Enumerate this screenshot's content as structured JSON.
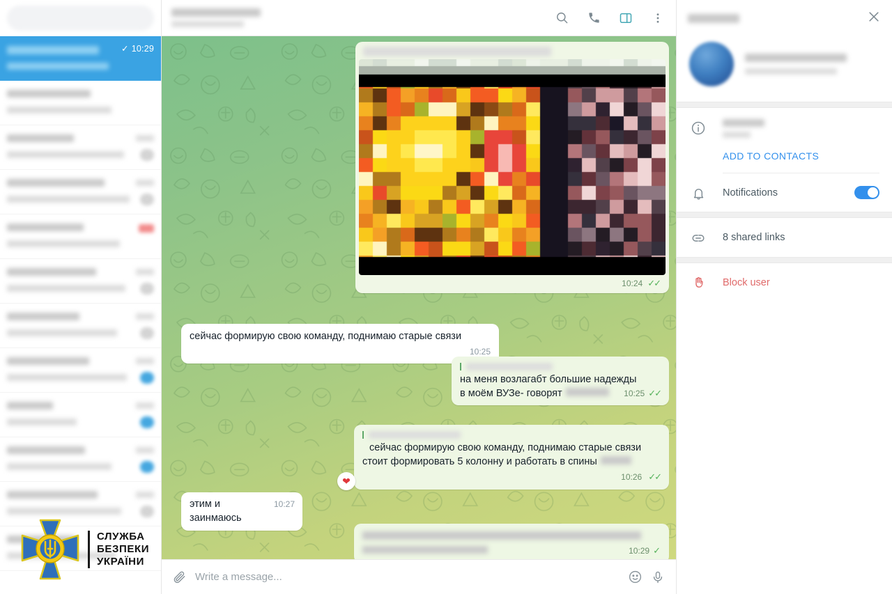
{
  "sidebar": {
    "search": {
      "placeholder": "",
      "value": ""
    },
    "selected_chat": {
      "time": "10:29",
      "check": "✓"
    },
    "rows": [
      {
        "name_w": 120,
        "snippet_w": 150,
        "badge": "none"
      },
      {
        "name_w": 96,
        "snippet_w": 168,
        "badge": "grey"
      },
      {
        "name_w": 140,
        "snippet_w": 176,
        "badge": "grey"
      },
      {
        "name_w": 110,
        "snippet_w": 162,
        "badge": "red"
      },
      {
        "name_w": 128,
        "snippet_w": 170,
        "badge": "grey"
      },
      {
        "name_w": 104,
        "snippet_w": 158,
        "badge": "grey"
      },
      {
        "name_w": 118,
        "snippet_w": 172,
        "badge": "blue"
      },
      {
        "name_w": 66,
        "snippet_w": 100,
        "badge": "blue"
      },
      {
        "name_w": 112,
        "snippet_w": 150,
        "badge": "blue"
      },
      {
        "name_w": 130,
        "snippet_w": 164,
        "badge": "grey"
      },
      {
        "name_w": 98,
        "snippet_w": 156,
        "badge": "none"
      }
    ],
    "watermark": {
      "line1": "СЛУЖБА",
      "line2": "БЕЗПЕКИ",
      "line3": "УКРАЇНИ",
      "emblem_colors": {
        "cross": "#2e6fba",
        "gold": "#f3c912",
        "outline": "#15488f"
      }
    }
  },
  "chat_header": {
    "title_redacted": true,
    "status_redacted": true,
    "icons": [
      "search-icon",
      "call-icon",
      "info-panel-icon",
      "more-menu-icon"
    ],
    "active_icon": "info-panel-icon",
    "active_color": "#45a8b5"
  },
  "messages": [
    {
      "id": "photo",
      "type": "photo",
      "direction": "out",
      "time": "10:24",
      "status": "read",
      "redacted_caption": true
    },
    {
      "id": "m1",
      "type": "text",
      "direction": "in",
      "text": "сейчас формирую свою команду, поднимаю старые связи",
      "time": "10:25",
      "status": "none"
    },
    {
      "id": "m2",
      "type": "text",
      "direction": "out",
      "reply_redacted": true,
      "text_line1": "на меня возлагабт большие надежды",
      "text_line2": "в моём ВУЗе- говорят",
      "line2_redacted": true,
      "time": "10:25",
      "status": "read"
    },
    {
      "id": "m3",
      "type": "text",
      "direction": "out",
      "reply_redacted": true,
      "text_line1": "сейчас формирую свою команду, поднимаю старые связи",
      "text_line2": "стоит формировать 5 колонну и работать в спины",
      "line2_redacted": true,
      "time": "10:26",
      "status": "read",
      "reaction": "❤"
    },
    {
      "id": "m4",
      "type": "text",
      "direction": "in",
      "text": "этим и заинмаюсь",
      "time": "10:27",
      "status": "none"
    },
    {
      "id": "m5",
      "type": "text",
      "direction": "out",
      "redacted": true,
      "time": "10:29",
      "status": "sent"
    }
  ],
  "composer": {
    "placeholder": "Write a message...",
    "attach_icon": "paperclip-icon",
    "emoji_icon": "smiley-icon",
    "voice_icon": "microphone-icon"
  },
  "right_panel": {
    "header_title_redacted": true,
    "close_icon": "close-icon",
    "profile": {
      "name_redacted": true,
      "status_redacted": true
    },
    "info": {
      "icon": "info-icon",
      "username_redacted": true,
      "add_to_contacts": "ADD TO CONTACTS"
    },
    "notifications": {
      "icon": "bell-icon",
      "label": "Notifications",
      "enabled": true
    },
    "shared_links": {
      "icon": "link-icon",
      "label": "8 shared links"
    },
    "block": {
      "icon": "hand-icon",
      "label": "Block user",
      "color": "#e06a6a"
    }
  },
  "colors": {
    "accent_blue": "#3390ec",
    "selected_row": "#3aa3e3",
    "bubble_out": "#eef7e4",
    "bubble_in": "#ffffff",
    "tick_green": "#55b25b",
    "danger": "#e06a6a"
  }
}
